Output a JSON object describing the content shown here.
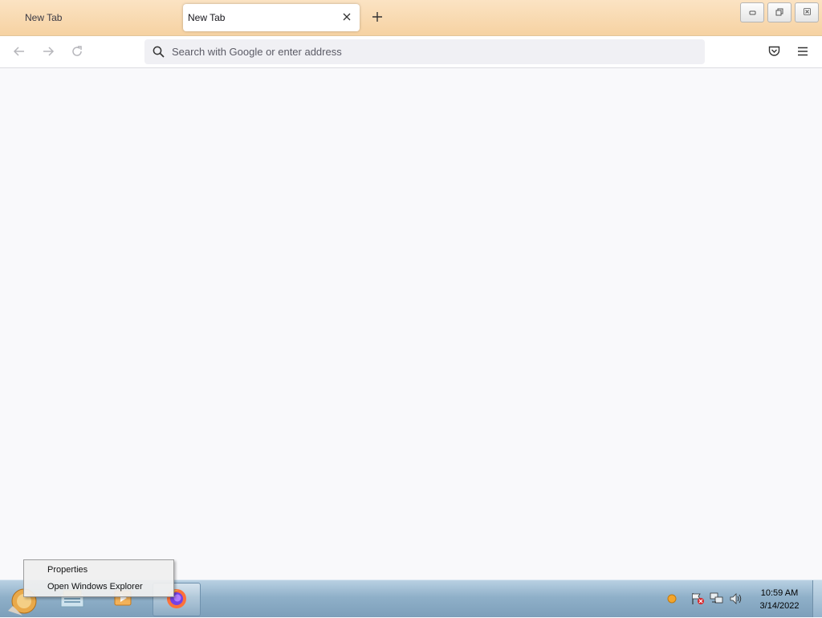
{
  "browser": {
    "tabs": [
      {
        "label": "New Tab",
        "active": false
      },
      {
        "label": "New Tab",
        "active": true
      }
    ],
    "tab_close_icon": "close-icon",
    "new_tab_icon": "plus-icon",
    "window_controls": {
      "minimize": "minimize-icon",
      "restore": "restore-icon",
      "close": "close-icon"
    },
    "toolbar": {
      "back_icon": "arrow-left-icon",
      "forward_icon": "arrow-right-icon",
      "reload_icon": "reload-icon",
      "search_icon": "search-icon",
      "address_placeholder": "Search with Google or enter address",
      "address_value": "",
      "pocket_icon": "pocket-icon",
      "menu_icon": "hamburger-menu-icon"
    }
  },
  "context_menu": {
    "items": [
      {
        "label": "Properties"
      },
      {
        "label": "Open Windows Explorer"
      }
    ]
  },
  "taskbar": {
    "apps": [
      "start-orb-icon",
      "windows-explorer-icon",
      "media-player-icon",
      "firefox-icon"
    ],
    "tray_icons": [
      "update-notification-icon",
      "action-center-flag-icon",
      "network-icon",
      "volume-icon"
    ],
    "clock": {
      "time": "10:59 AM",
      "date": "3/14/2022"
    }
  },
  "colors": {
    "tabstrip": "#f6d2a2",
    "toolbar": "#ffffff",
    "content_bg": "#f9f9fb",
    "taskbar": "#8fb0c9"
  }
}
